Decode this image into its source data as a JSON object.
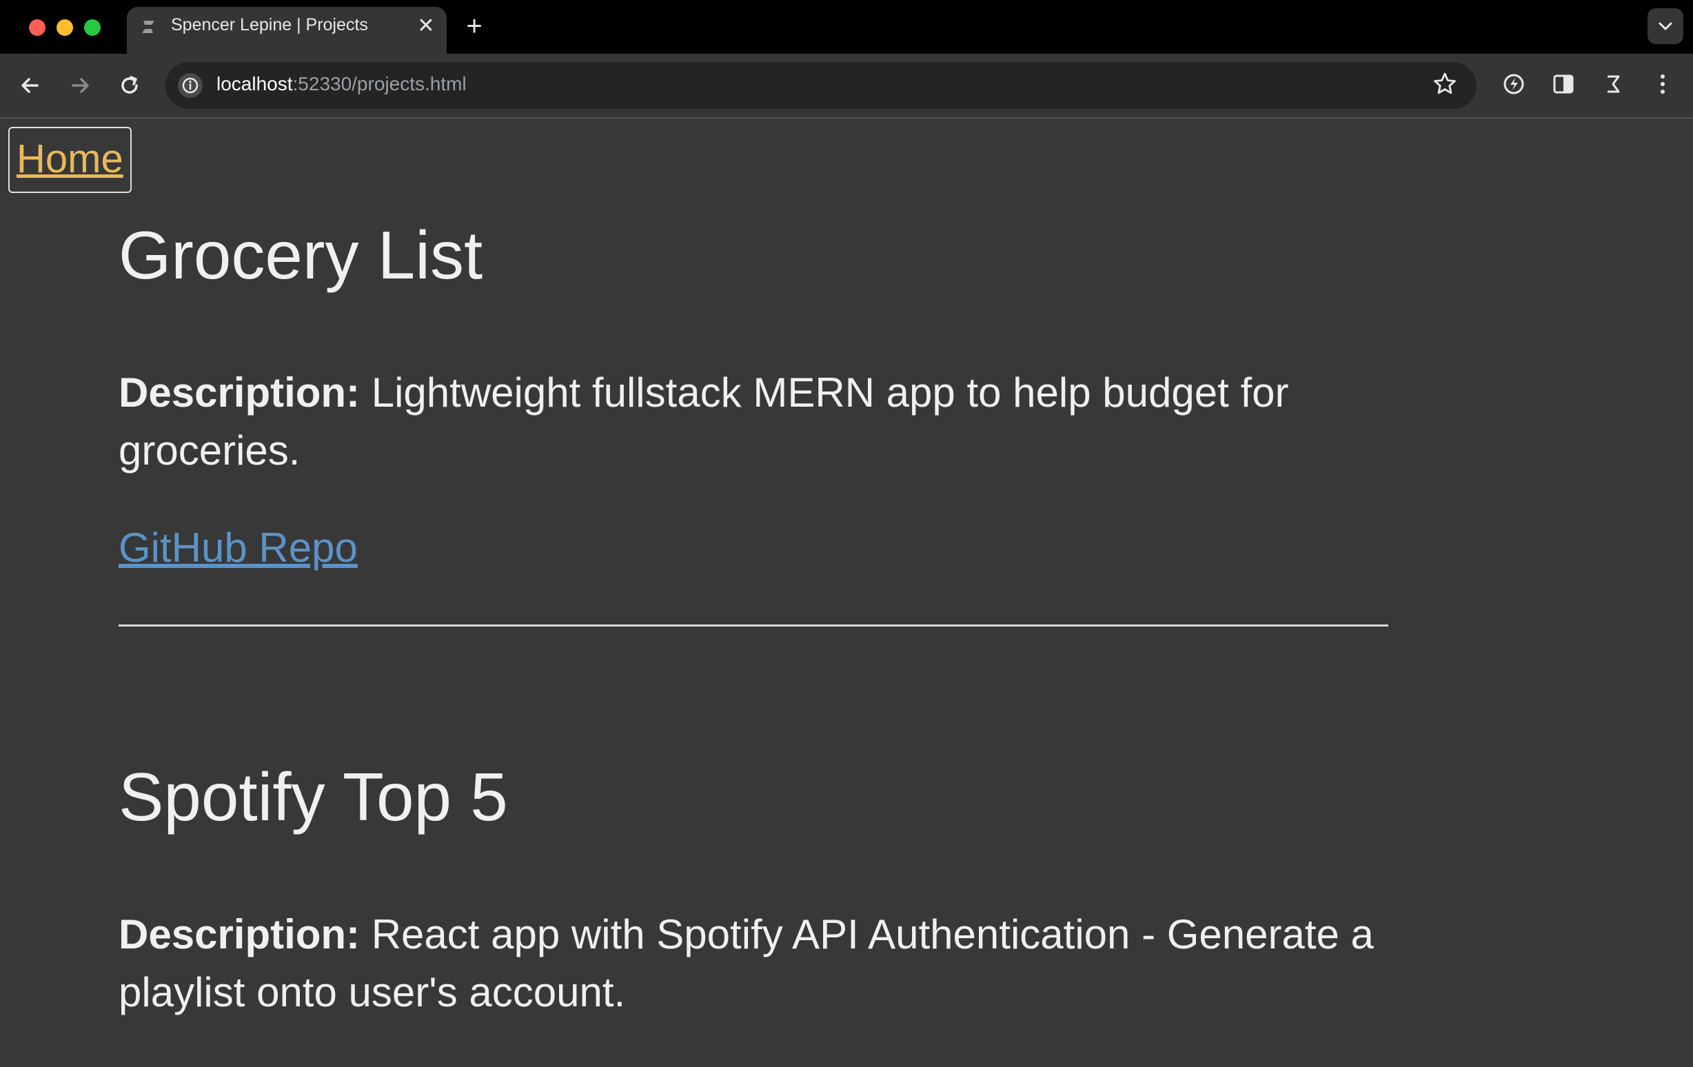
{
  "browser": {
    "tab_title": "Spencer Lepine | Projects",
    "tab_close": "✕",
    "new_tab": "+",
    "url_host": "localhost",
    "url_path": ":52330/projects.html"
  },
  "nav": {
    "home_label": "Home"
  },
  "projects": [
    {
      "title": "Grocery List",
      "description_label": "Description:",
      "description": " Lightweight fullstack MERN app to help budget for groceries.",
      "link_label": "GitHub Repo"
    },
    {
      "title": "Spotify Top 5",
      "description_label": "Description:",
      "description": " React app with Spotify API Authentication - Generate a playlist onto user's account."
    }
  ],
  "colors": {
    "page_background": "#383838",
    "home_link": "#e9b959",
    "repo_link": "#5b93c7"
  }
}
